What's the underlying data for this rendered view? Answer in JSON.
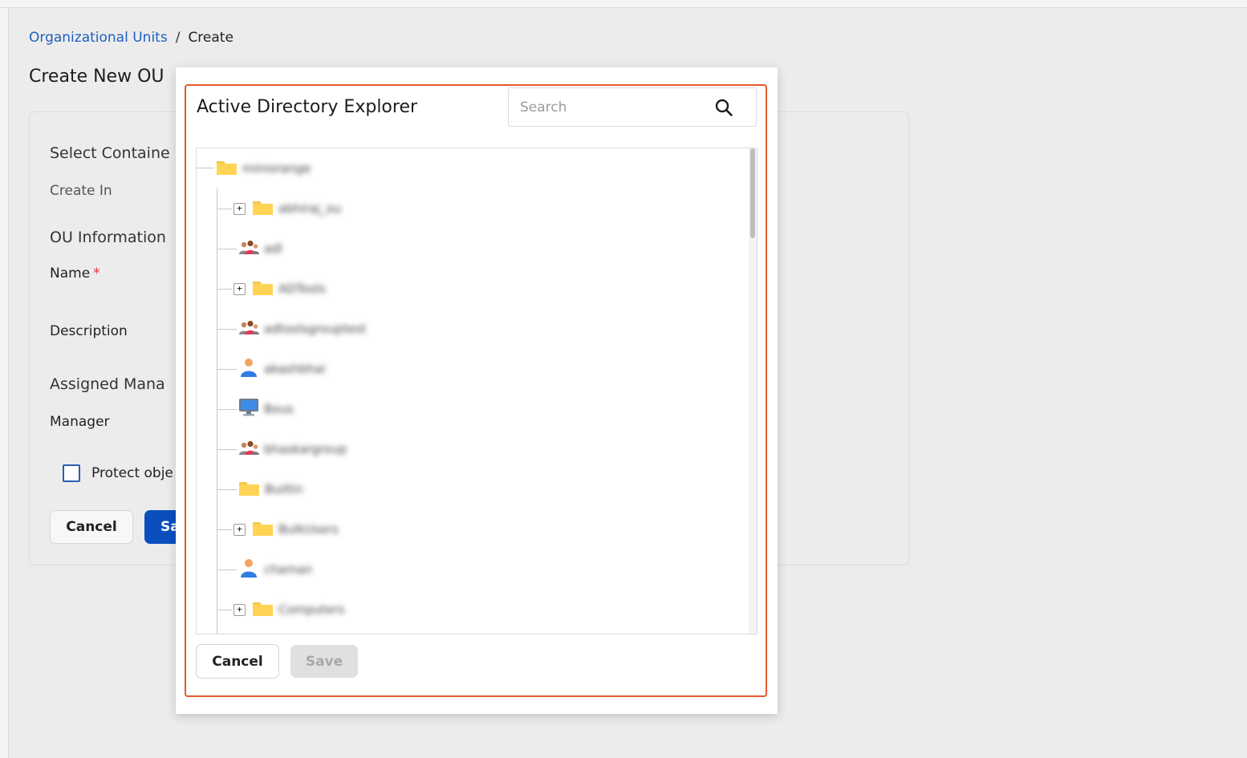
{
  "breadcrumb": {
    "parent": "Organizational Units",
    "separator": "/",
    "current": "Create"
  },
  "page": {
    "title": "Create New OU"
  },
  "form": {
    "select_container_heading": "Select Containe",
    "create_in_label": "Create In",
    "ou_info_heading": "OU Information",
    "name_label": "Name",
    "required_mark": "*",
    "description_label": "Description",
    "assigned_manager_heading": "Assigned Mana",
    "manager_label": "Manager",
    "protect_label": "Protect obje",
    "cancel_label": "Cancel",
    "save_label": "Sa"
  },
  "modal": {
    "title": "Active Directory Explorer",
    "search_placeholder": "Search",
    "cancel_label": "Cancel",
    "save_label": "Save",
    "accent_color": "#e45a2c",
    "tree": {
      "root": {
        "icon": "folder-icon",
        "label": "miniorange"
      },
      "children": [
        {
          "icon": "folder-icon",
          "expandable": true,
          "expander": "+",
          "label": "abhiraj_ou"
        },
        {
          "icon": "group-icon",
          "expandable": false,
          "label": "adl"
        },
        {
          "icon": "folder-icon",
          "expandable": true,
          "expander": "+",
          "label": "ADTools"
        },
        {
          "icon": "group-icon",
          "expandable": false,
          "label": "adtoolsgrouptest"
        },
        {
          "icon": "user-icon",
          "expandable": false,
          "label": "akashbhai"
        },
        {
          "icon": "computer-icon",
          "expandable": false,
          "label": "Bous"
        },
        {
          "icon": "group-icon",
          "expandable": false,
          "label": "bhaskargroup"
        },
        {
          "icon": "folder-icon",
          "expandable": false,
          "label": "Builtin"
        },
        {
          "icon": "folder-icon",
          "expandable": true,
          "expander": "+",
          "label": "BulkUsers"
        },
        {
          "icon": "user-icon",
          "expandable": false,
          "label": "chaman"
        },
        {
          "icon": "folder-icon",
          "expandable": true,
          "expander": "+",
          "label": "Computers"
        }
      ]
    }
  }
}
